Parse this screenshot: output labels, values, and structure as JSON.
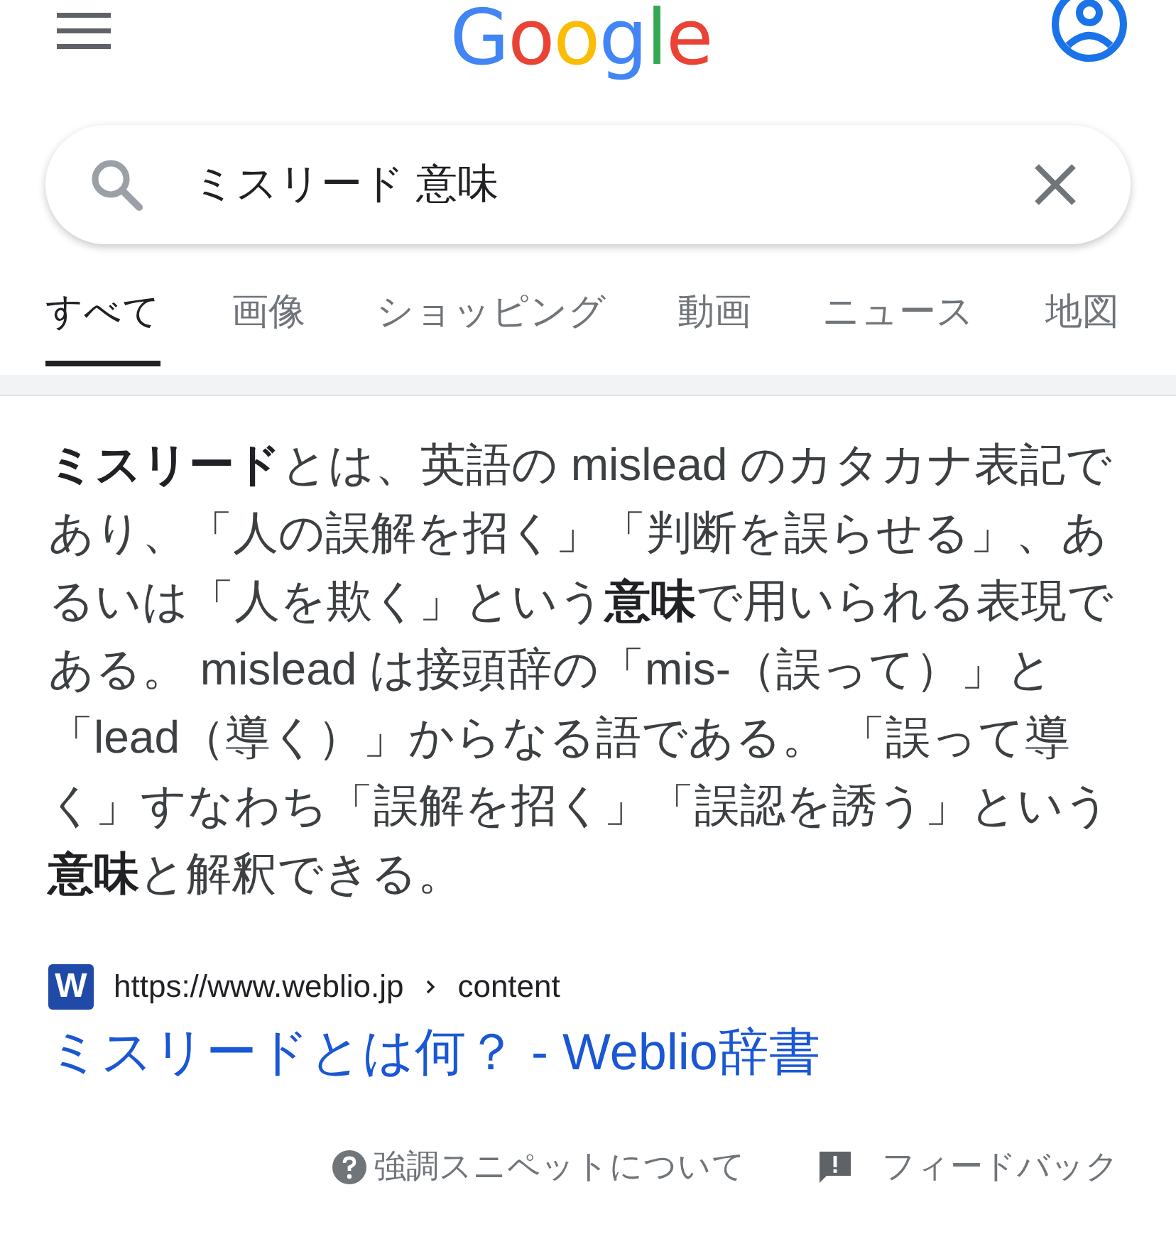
{
  "header": {
    "logo": "Google"
  },
  "search": {
    "value": "ミスリード 意味"
  },
  "tabs": [
    {
      "label": "すべて",
      "selected": true
    },
    {
      "label": "画像",
      "selected": false
    },
    {
      "label": "ショッピング",
      "selected": false
    },
    {
      "label": "動画",
      "selected": false
    },
    {
      "label": "ニュース",
      "selected": false
    },
    {
      "label": "地図",
      "selected": false
    }
  ],
  "snippet": {
    "text": "**ミスリード**とは、英語の mislead のカタカナ表記であり、「人の誤解を招く」「判断を誤らせる」、あるいは「人を欺く」という**意味**で用いられる表現である。 mislead は接頭辞の「mis-（誤って）」と「lead（導く）」からなる語である。 「誤って導く」すなわち「誤解を招く」「誤認を誘う」という**意味**と解釈できる。",
    "favicon": "W",
    "url": "https://www.weblio.jp",
    "breadcrumb": "content",
    "title": "ミスリードとは何？ - Weblio辞書"
  },
  "footer": {
    "about": "強調スニペットについて",
    "feedback": "フィードバック"
  }
}
